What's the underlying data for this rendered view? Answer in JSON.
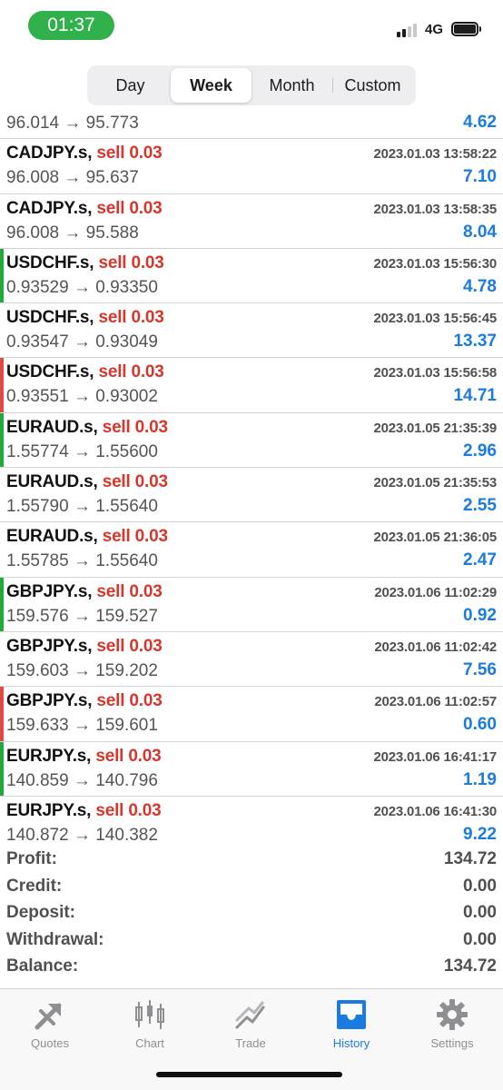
{
  "status_bar": {
    "time": "01:37",
    "network": "4G",
    "time_pill_color": "#30b14b"
  },
  "period_tabs": [
    {
      "label": "Day",
      "active": false
    },
    {
      "label": "Week",
      "active": true
    },
    {
      "label": "Month",
      "active": false
    },
    {
      "label": "Custom",
      "active": false
    }
  ],
  "colors": {
    "sell": "#d6362b",
    "profit": "#1a7be0",
    "marker_green": "#22a93b",
    "marker_red": "#df4b41",
    "accent": "#1a7be0"
  },
  "trades": [
    {
      "symbol": "",
      "side": "",
      "time": "",
      "prices": "96.014 → 95.773",
      "profit": "4.62",
      "marker": "none"
    },
    {
      "symbol": "CADJPY.s,",
      "side": "sell 0.03",
      "time": "2023.01.03 13:58:22",
      "prices": "96.008 → 95.637",
      "profit": "7.10",
      "marker": "none"
    },
    {
      "symbol": "CADJPY.s,",
      "side": "sell 0.03",
      "time": "2023.01.03 13:58:35",
      "prices": "96.008 → 95.588",
      "profit": "8.04",
      "marker": "none"
    },
    {
      "symbol": "USDCHF.s,",
      "side": "sell 0.03",
      "time": "2023.01.03 15:56:30",
      "prices": "0.93529 → 0.93350",
      "profit": "4.78",
      "marker": "green"
    },
    {
      "symbol": "USDCHF.s,",
      "side": "sell 0.03",
      "time": "2023.01.03 15:56:45",
      "prices": "0.93547 → 0.93049",
      "profit": "13.37",
      "marker": "none"
    },
    {
      "symbol": "USDCHF.s,",
      "side": "sell 0.03",
      "time": "2023.01.03 15:56:58",
      "prices": "0.93551 → 0.93002",
      "profit": "14.71",
      "marker": "red"
    },
    {
      "symbol": "EURAUD.s,",
      "side": "sell 0.03",
      "time": "2023.01.05 21:35:39",
      "prices": "1.55774 → 1.55600",
      "profit": "2.96",
      "marker": "green"
    },
    {
      "symbol": "EURAUD.s,",
      "side": "sell 0.03",
      "time": "2023.01.05 21:35:53",
      "prices": "1.55790 → 1.55640",
      "profit": "2.55",
      "marker": "none"
    },
    {
      "symbol": "EURAUD.s,",
      "side": "sell 0.03",
      "time": "2023.01.05 21:36:05",
      "prices": "1.55785 → 1.55640",
      "profit": "2.47",
      "marker": "none"
    },
    {
      "symbol": "GBPJPY.s,",
      "side": "sell 0.03",
      "time": "2023.01.06 11:02:29",
      "prices": "159.576 → 159.527",
      "profit": "0.92",
      "marker": "green"
    },
    {
      "symbol": "GBPJPY.s,",
      "side": "sell 0.03",
      "time": "2023.01.06 11:02:42",
      "prices": "159.603 → 159.202",
      "profit": "7.56",
      "marker": "none"
    },
    {
      "symbol": "GBPJPY.s,",
      "side": "sell 0.03",
      "time": "2023.01.06 11:02:57",
      "prices": "159.633 → 159.601",
      "profit": "0.60",
      "marker": "red"
    },
    {
      "symbol": "EURJPY.s,",
      "side": "sell 0.03",
      "time": "2023.01.06 16:41:17",
      "prices": "140.859 → 140.796",
      "profit": "1.19",
      "marker": "green"
    },
    {
      "symbol": "EURJPY.s,",
      "side": "sell 0.03",
      "time": "2023.01.06 16:41:30",
      "prices": "140.872 → 140.382",
      "profit": "9.22",
      "marker": "none"
    }
  ],
  "summary": [
    {
      "label": "Profit:",
      "value": "134.72"
    },
    {
      "label": "Credit:",
      "value": "0.00"
    },
    {
      "label": "Deposit:",
      "value": "0.00"
    },
    {
      "label": "Withdrawal:",
      "value": "0.00"
    },
    {
      "label": "Balance:",
      "value": "134.72"
    }
  ],
  "tabbar": [
    {
      "label": "Quotes",
      "icon": "quotes-icon",
      "active": false
    },
    {
      "label": "Chart",
      "icon": "chart-icon",
      "active": false
    },
    {
      "label": "Trade",
      "icon": "trade-icon",
      "active": false
    },
    {
      "label": "History",
      "icon": "history-icon",
      "active": true
    },
    {
      "label": "Settings",
      "icon": "settings-icon",
      "active": false
    }
  ]
}
